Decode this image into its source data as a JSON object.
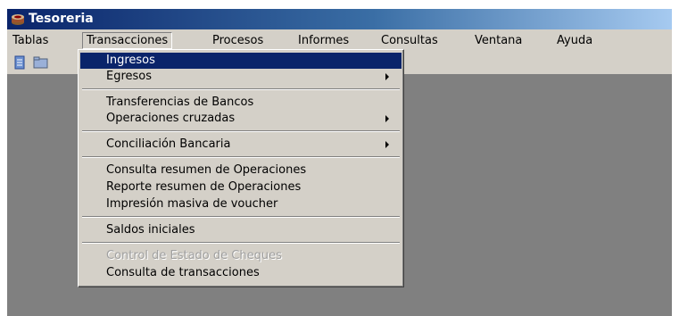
{
  "window": {
    "title": "Tesoreria"
  },
  "menubar": {
    "items": [
      "Tablas",
      "Transacciones",
      "Procesos",
      "Informes",
      "Consultas",
      "Ventana",
      "Ayuda"
    ]
  },
  "toolbar": {
    "buttons": [
      "document-icon",
      "folder-icon"
    ]
  },
  "dropdown": {
    "items": [
      {
        "label": "Ingresos",
        "selected": true,
        "submenu": false,
        "enabled": true
      },
      {
        "label": "Egresos",
        "selected": false,
        "submenu": true,
        "enabled": true
      },
      {
        "label": "Transferencias de Bancos",
        "selected": false,
        "submenu": false,
        "enabled": true
      },
      {
        "label": "Operaciones cruzadas",
        "selected": false,
        "submenu": true,
        "enabled": true
      },
      {
        "label": "Conciliación Bancaria",
        "selected": false,
        "submenu": true,
        "enabled": true
      },
      {
        "label": "Consulta resumen de Operaciones",
        "selected": false,
        "submenu": false,
        "enabled": true
      },
      {
        "label": "Reporte resumen de Operaciones",
        "selected": false,
        "submenu": false,
        "enabled": true
      },
      {
        "label": "Impresión masiva de voucher",
        "selected": false,
        "submenu": false,
        "enabled": true
      },
      {
        "label": "Saldos iniciales",
        "selected": false,
        "submenu": false,
        "enabled": true
      },
      {
        "label": "Control de Estado de Cheques",
        "selected": false,
        "submenu": false,
        "enabled": false
      },
      {
        "label": "Consulta de transacciones",
        "selected": false,
        "submenu": false,
        "enabled": true
      }
    ]
  },
  "colors": {
    "titlebar_start": "#0a246a",
    "titlebar_end": "#a6caf0",
    "selection": "#0a246a",
    "face": "#d4d0c8",
    "workspace": "#808080"
  }
}
